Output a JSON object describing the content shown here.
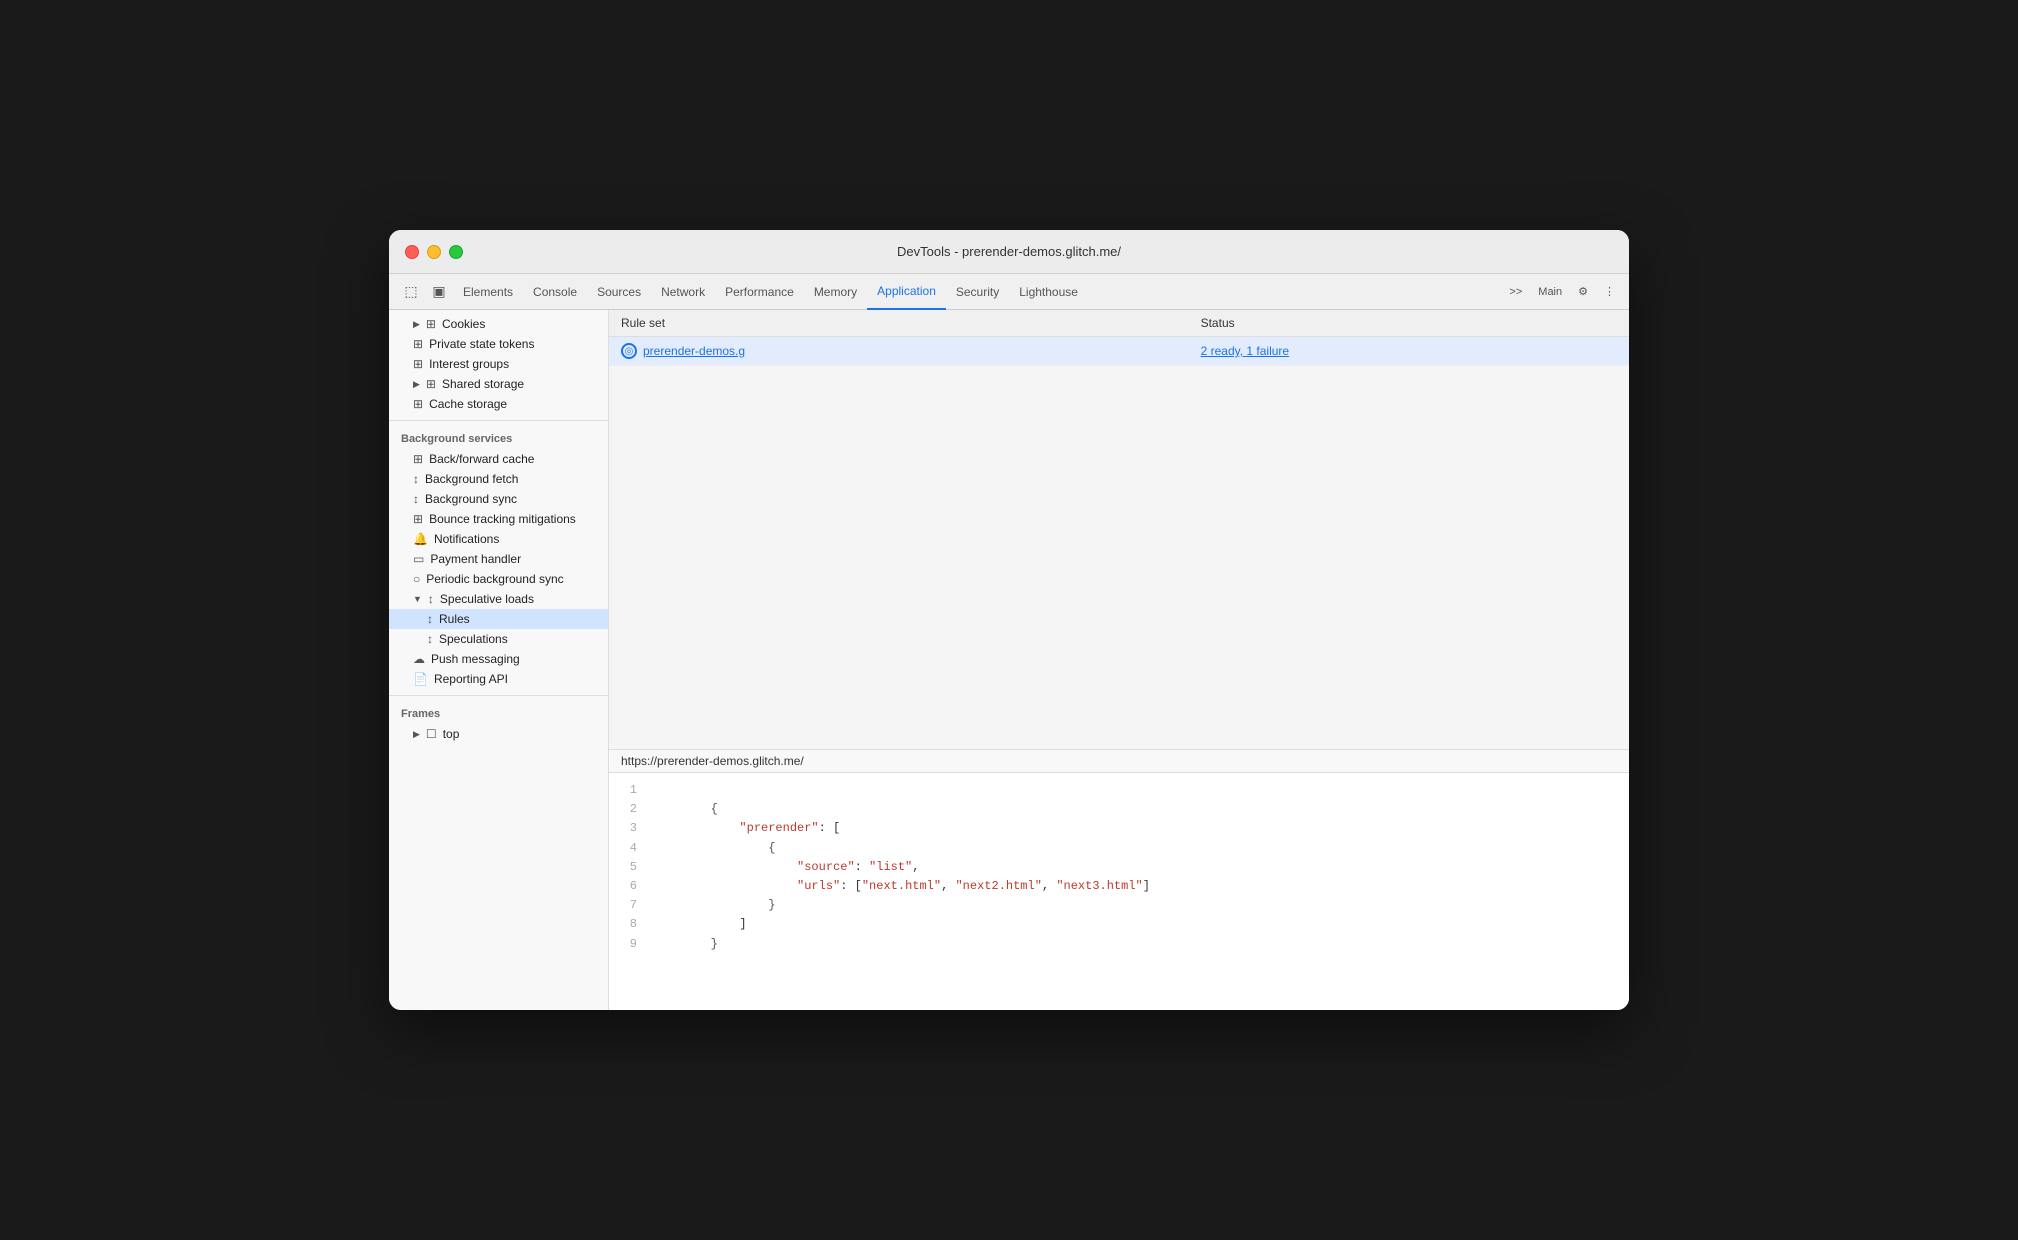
{
  "window": {
    "title": "DevTools - prerender-demos.glitch.me/"
  },
  "tabs": [
    {
      "label": "Elements",
      "active": false
    },
    {
      "label": "Console",
      "active": false
    },
    {
      "label": "Sources",
      "active": false
    },
    {
      "label": "Network",
      "active": false
    },
    {
      "label": "Performance",
      "active": false
    },
    {
      "label": "Memory",
      "active": false
    },
    {
      "label": "Application",
      "active": true
    },
    {
      "label": "Security",
      "active": false
    },
    {
      "label": "Lighthouse",
      "active": false
    }
  ],
  "tab_overflow": ">>",
  "tab_main": "Main",
  "tab_gear": "⚙",
  "tab_more": "⋮",
  "sidebar": {
    "sections": [
      {
        "items": [
          {
            "label": "Cookies",
            "icon": "▶ 🗄",
            "indent": 1,
            "expandable": true
          },
          {
            "label": "Private state tokens",
            "icon": "🗄",
            "indent": 1
          },
          {
            "label": "Interest groups",
            "icon": "🗄",
            "indent": 1
          },
          {
            "label": "Shared storage",
            "icon": "▶ 🗄",
            "indent": 1,
            "expandable": true
          },
          {
            "label": "Cache storage",
            "icon": "🗄",
            "indent": 1
          }
        ]
      },
      {
        "header": "Background services",
        "items": [
          {
            "label": "Back/forward cache",
            "icon": "🗄",
            "indent": 1
          },
          {
            "label": "Background fetch",
            "icon": "↕",
            "indent": 1
          },
          {
            "label": "Background sync",
            "icon": "↕",
            "indent": 1
          },
          {
            "label": "Bounce tracking mitigations",
            "icon": "🗄",
            "indent": 1
          },
          {
            "label": "Notifications",
            "icon": "🔔",
            "indent": 1
          },
          {
            "label": "Payment handler",
            "icon": "💳",
            "indent": 1
          },
          {
            "label": "Periodic background sync",
            "icon": "🕐",
            "indent": 1
          },
          {
            "label": "Speculative loads",
            "icon": "▼ ↕",
            "indent": 1,
            "expandable": true,
            "expanded": true
          },
          {
            "label": "Rules",
            "icon": "↕",
            "indent": 2,
            "active": true
          },
          {
            "label": "Speculations",
            "icon": "↕",
            "indent": 2
          },
          {
            "label": "Push messaging",
            "icon": "☁",
            "indent": 1
          },
          {
            "label": "Reporting API",
            "icon": "📄",
            "indent": 1
          }
        ]
      },
      {
        "header": "Frames",
        "items": [
          {
            "label": "top",
            "icon": "▶ ☐",
            "indent": 1,
            "expandable": true
          }
        ]
      }
    ]
  },
  "table": {
    "columns": [
      {
        "label": "Rule set",
        "key": "rule_set"
      },
      {
        "label": "Status",
        "key": "status"
      }
    ],
    "rows": [
      {
        "rule_set": "prerender-demos.g",
        "rule_set_full": "https://prerender-demos.glitch.me/",
        "status": "2 ready, 1 failure",
        "selected": true
      }
    ]
  },
  "bottom_panel": {
    "url": "https://prerender-demos.glitch.me/",
    "code_lines": [
      {
        "num": "1",
        "content": ""
      },
      {
        "num": "2",
        "content": "    {"
      },
      {
        "num": "3",
        "content": "        \"prerender\": ["
      },
      {
        "num": "4",
        "content": "            {"
      },
      {
        "num": "5",
        "content": "                \"source\": \"list\","
      },
      {
        "num": "6",
        "content": "                \"urls\": [\"next.html\", \"next2.html\", \"next3.html\"]"
      },
      {
        "num": "7",
        "content": "            }"
      },
      {
        "num": "8",
        "content": "        ]"
      },
      {
        "num": "9",
        "content": "    }"
      }
    ]
  }
}
